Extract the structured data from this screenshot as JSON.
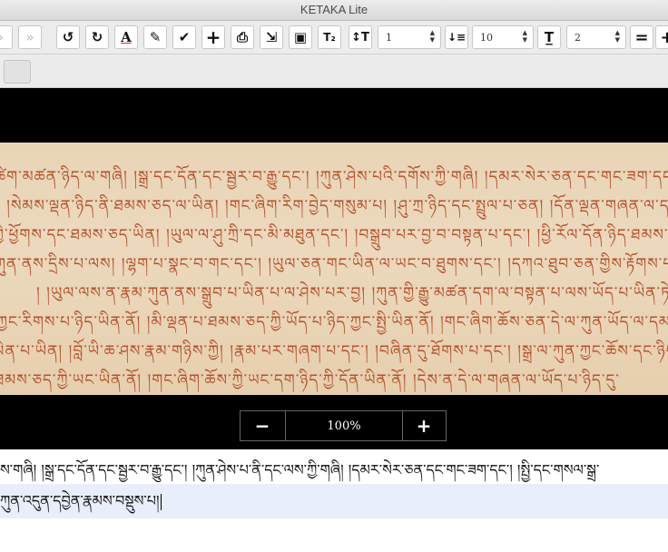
{
  "window": {
    "title": "KETAKA Lite"
  },
  "toolbar": {
    "buttons": [
      {
        "icon": "chevron-right-icon",
        "glyph": "›"
      },
      {
        "icon": "fast-forward-icon",
        "glyph": "»"
      },
      {
        "icon": "undo-icon",
        "glyph": "↺"
      },
      {
        "icon": "redo-icon",
        "glyph": "↻"
      },
      {
        "icon": "text-color-icon",
        "glyph": "A"
      },
      {
        "icon": "pencil-icon",
        "glyph": "✎"
      },
      {
        "icon": "checkmark-icon",
        "glyph": "✔"
      },
      {
        "icon": "plus-icon",
        "glyph": "+"
      },
      {
        "icon": "printer-icon",
        "glyph": "⎙"
      },
      {
        "icon": "export-document-icon",
        "glyph": "⇲"
      },
      {
        "icon": "image-icon",
        "glyph": "▣"
      },
      {
        "icon": "subscript-icon",
        "glyph": "T₂"
      },
      {
        "icon": "text-height-icon",
        "glyph": "↕T"
      },
      {
        "icon": "sort-order-icon",
        "glyph": "↓≡"
      },
      {
        "icon": "text-underline-icon",
        "glyph": "T̲"
      },
      {
        "icon": "equals-icon",
        "glyph": "="
      },
      {
        "icon": "add-icon",
        "glyph": "+"
      }
    ],
    "line_select": "1",
    "size_select": "10",
    "spacing_select": "2",
    "text_color_accent": "#d32f2f"
  },
  "manuscript": {
    "lines": [
      "ཚིག་མཚན་ཉིད་ལ་གཞི། །སྒྲ་དང་དོན་དང་སྦྱར་བ་རྒྱུ་དང་། །ཀུན་ཤེས་པའི་དགོས་ཀྱི་གཞི། །དམར་སེར་ཅན་དང་གང་ཟག་དང་། །སྤྱི་",
      "། །སེམས་ལྡན་ཉིད་ནི་ཐམས་ཅད་ལ་ཡིན། །གང་ཞིག་རིག་བྱེད་གསུམ་པ། །ཤུ་ཀྲ་ཉིད་དང་སྤྲུལ་པ་ཅན། །དོན་ལྡན་གཞན་ལ་དག་ཉིད་",
      "ཀྱི་ཕྱོགས་དང་ཐམས་ཅད་ཡིན། །ཡུལ་ལ་ཤུ་ཀྲི་དང་མི་མཐུན་དང་། །བསྒྲུབ་པར་བྱ་བ་བསྟན་པ་དང་། །ཕྱི་རོལ་དོན་ཉིད་ཐམས་",
      "ཀུན་ནས་དྲིས་པ་ལས། །ལྷག་པ་སྣང་བ་གང་དང་། །ཡུལ་ཅན་གང་ཡིན་ལ་ཡང་བ་ཐུགས་དང་། །དཀའ་ཐུབ་ཅན་གྱིས་རྟོགས་པར་བྱ། །རྒྱལ་",
      "། །ཡུལ་ལས་ན་རྣམ་ཀུན་ནས་སྒྲུབ་པ་ཡིན་པ་ལ་ཤེས་པར་བྱ། །ཀུན་གྱི་རྒྱུ་མཚན་དག་ལ་བསྟན་པ་ལས་ཡོད་པ་ཡིན་ཏེ་དེ་སྐད་",
      "ཀྱང་རིགས་པ་ཉིད་ཡིན་ནོ། །མི་ལྡན་པ་ཐམས་ཅད་ཀྱི་ཡོད་པ་ཉིད་ཀྱང་སྤྱི་ཡིན་ནོ། །གང་ཞིག་ཆོས་ཅན་དེ་ལ་ཀུན་ཡོད་ལ་དམ་",
      "ཡིན་པ་ཡིན། །བློ་ཡི་ཆ་ཤས་རྣམ་གཉིས་ཀྱི། །རྣམ་པར་གཞག་པ་དང་། །བཞིན་དུ་ཐོགས་པ་དང་། །སྒྲ་ལ་ཀུན་ཀྱང་ཆོས་དང་ཉིད་ཀྱི་",
      "ཐམས་ཅད་ཀྱི་ཡང་ཡིན་ནོ། །གང་ཞིག་ཆོས་ཀྱི་ཡང་དག་ཉིད་ཀྱི་དོན་ཡིན་ནོ། །དེས་ན་དེ་ལ་གཞན་ལ་ཡོད་པ་ཉིད་དུ་"
    ]
  },
  "zoom": {
    "minus": "−",
    "value": "100%",
    "plus": "+"
  },
  "editor": {
    "line1": "ས་གཞི། །སྒྲ་དང་དོན་དང་སྦྱར་བ་རྒྱུ་དང་། །ཀུན་ཤེས་པ་ནི་དང་ལས་ཀྱི་གཞི། །དམར་སེར་ཅན་དང་གང་ཟག་དང་། །སྤྱི་དང་གསལ་སྒྲ་",
    "line2": "ཀུན་འདུན་དབྱེན་རྣམས་བསྡུས་པ།"
  }
}
